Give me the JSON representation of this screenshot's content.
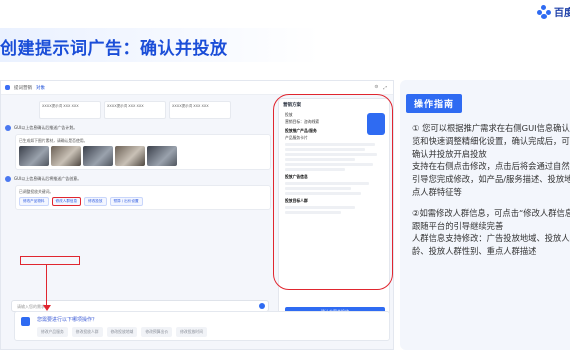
{
  "brand": {
    "name": "百度"
  },
  "slide_title": "创建提示词广告：确认并投放",
  "app": {
    "logo_text": "提词营销",
    "tab_label": "对象",
    "cards": [
      "XXXX提示词 XXX XXX",
      "XXXX提示词 XXX XXX",
      "XXXX提示词 XXX XXX"
    ],
    "messages": [
      "GUI以上信息确认后推送广告计划。",
      "已生成如下图片素材，请确认是否使用。",
      "GUI以上信息确认后将推送广告创意。",
      "已调整投放关键词。"
    ],
    "chips": [
      "修改产品物料",
      "修改人群信息",
      "修改投放",
      "预算 / 出价设置"
    ],
    "input_placeholder": "请输入您的需求",
    "footnote": "内容由AI生成，仅供参考",
    "suggest_question": "您需要进行以下哪项操作？",
    "suggest_options": [
      "修改产品服务",
      "修改投放人群",
      "修改投放地域",
      "修改预算出价",
      "修改投放时间"
    ],
    "side_panel": {
      "title": "营销方案",
      "lines": [
        "投放",
        "营销目标：咨询线索",
        "投放关键词",
        "产品服务卡片"
      ],
      "section1": "投放推广产品/服务",
      "section2": "投放广告信息",
      "section3": "投放目标人群",
      "cta": "确认方案并投放"
    }
  },
  "guide": {
    "title": "操作指南",
    "paragraph1": [
      "① 您可以根据推广需求在右侧GUI信息确认区",
      "览和快速调整精细化设置，确认完成后，可点",
      "确认并投放开启投放",
      "支持在右侧点击修改，点击后将会通过自然语言",
      "引导您完成修改，如产品/服务描述、投放地域、",
      "点人群特征等"
    ],
    "paragraph2": [
      "②如需修改人群信息，可点击“修改人群信息",
      "跟随平台的引导继续完善",
      "人群信息支持修改：广告投放地域、投放人群",
      "龄、投放人群性别、重点人群描述"
    ]
  },
  "colors": {
    "accent": "#2f6bf2",
    "title": "#1b4ed8",
    "annotation": "#e0262f"
  }
}
